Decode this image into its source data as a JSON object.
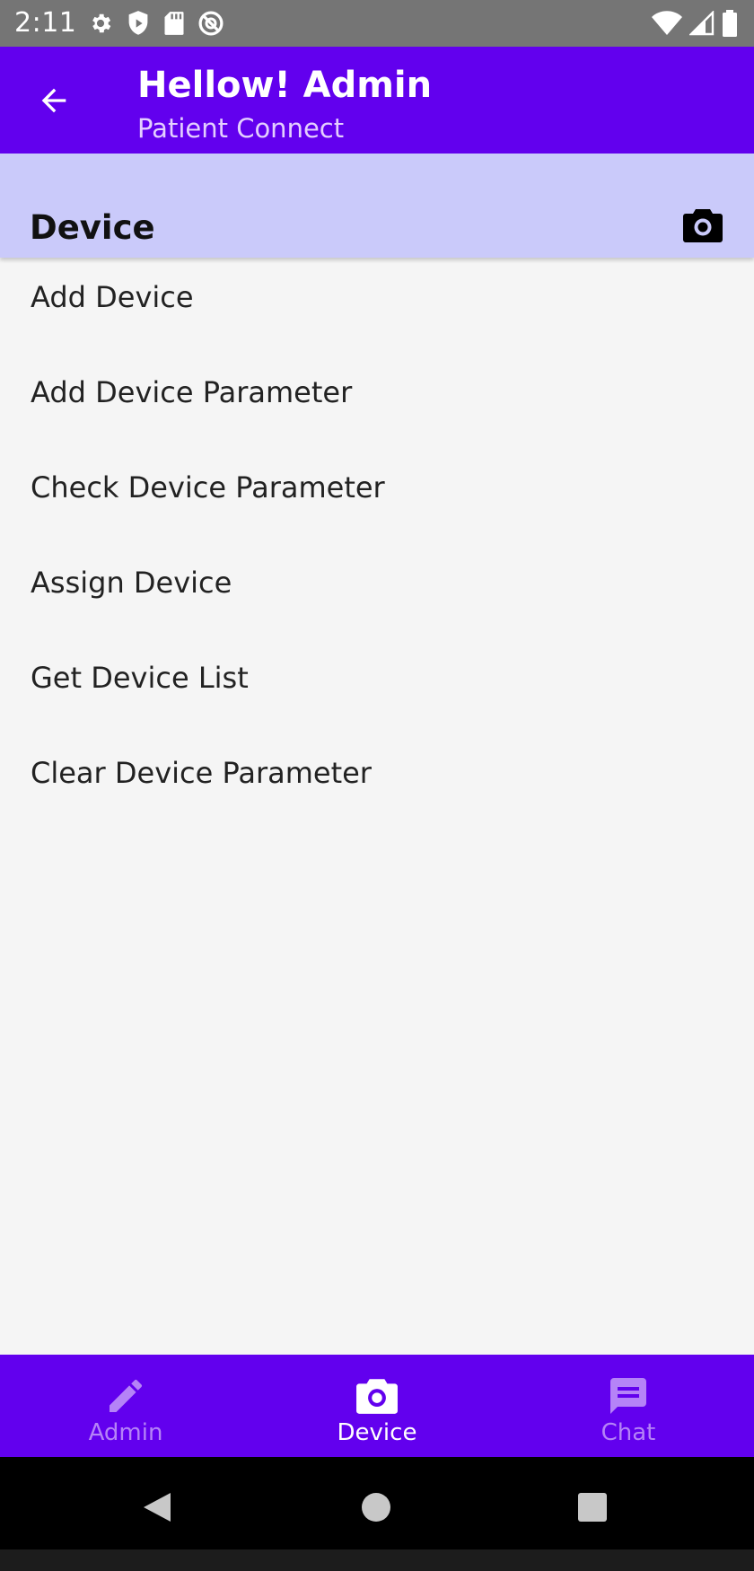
{
  "status_bar": {
    "time": "2:11",
    "left_icons": [
      "gear-icon",
      "shield-icon",
      "sd-card-icon",
      "no-sync-icon"
    ],
    "right_icons": [
      "wifi-icon",
      "signal-icon",
      "battery-icon"
    ]
  },
  "app_bar": {
    "title": "Hellow! Admin",
    "subtitle": "Patient Connect",
    "back_icon": "arrow-back-icon"
  },
  "section": {
    "title": "Device",
    "action_icon": "camera-icon"
  },
  "menu": {
    "items": [
      {
        "label": "Add Device"
      },
      {
        "label": "Add Device Parameter"
      },
      {
        "label": "Check Device Parameter"
      },
      {
        "label": "Assign Device"
      },
      {
        "label": "Get Device List"
      },
      {
        "label": "Clear Device Parameter"
      }
    ]
  },
  "bottom_nav": {
    "items": [
      {
        "label": "Admin",
        "icon": "pencil-icon",
        "active": false
      },
      {
        "label": "Device",
        "icon": "camera-icon",
        "active": true
      },
      {
        "label": "Chat",
        "icon": "chat-icon",
        "active": false
      }
    ]
  },
  "system_nav": {
    "buttons": [
      "back-triangle-icon",
      "home-circle-icon",
      "recents-square-icon"
    ]
  },
  "colors": {
    "primary": "#6200ee",
    "status_bar": "#757575",
    "section_header": "#cacafa",
    "background": "#f5f5f5",
    "nav_inactive": "#b583f7",
    "nav_active": "#ffffff",
    "subtitle": "#e4cfff"
  }
}
